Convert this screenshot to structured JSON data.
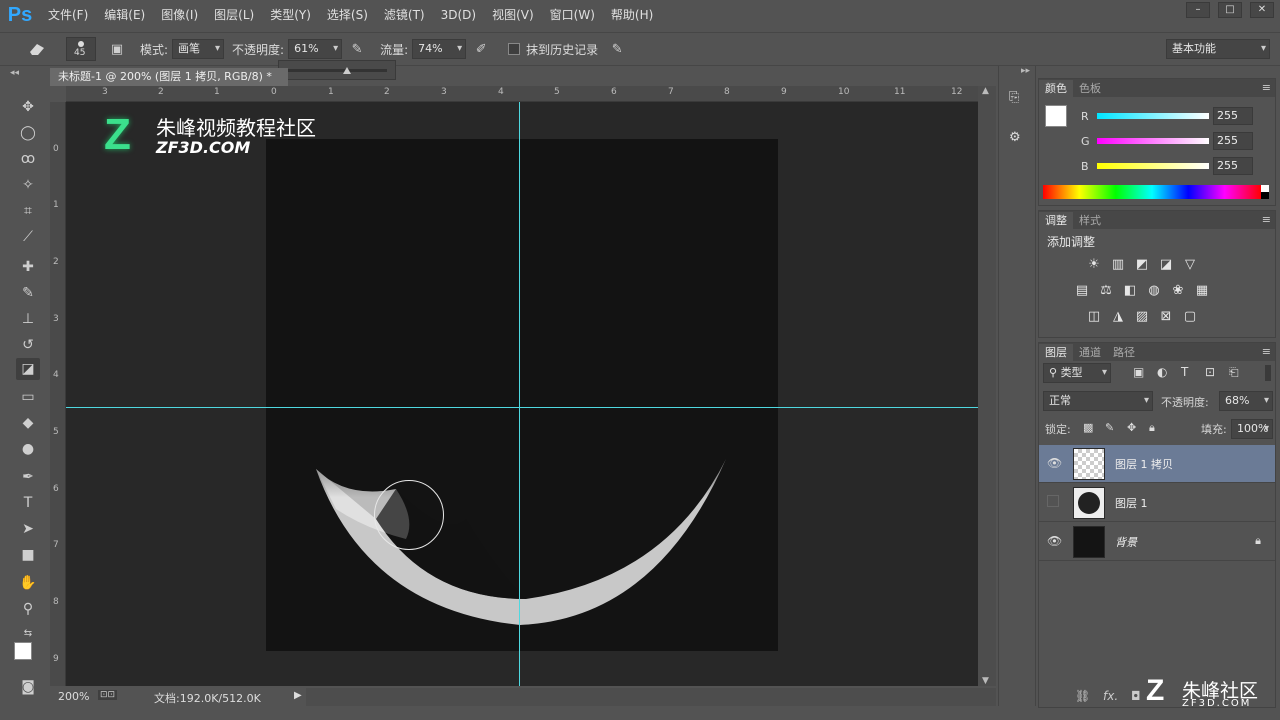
{
  "app": {
    "logo": "Ps",
    "menu": [
      "文件(F)",
      "编辑(E)",
      "图像(I)",
      "图层(L)",
      "类型(Y)",
      "选择(S)",
      "滤镜(T)",
      "3D(D)",
      "视图(V)",
      "窗口(W)",
      "帮助(H)"
    ],
    "window_controls": [
      "–",
      "□",
      "✕"
    ]
  },
  "options": {
    "brush_size": "45",
    "mode_label": "模式:",
    "mode_value": "画笔",
    "opacity_label": "不透明度:",
    "opacity_value": "61%",
    "flow_label": "流量:",
    "flow_value": "74%",
    "erase_history_label": "抹到历史记录",
    "workspace": "基本功能"
  },
  "document": {
    "tab_title": "未标题-1 @ 200% (图层 1 拷贝, RGB/8) *",
    "ruler_top": [
      "3",
      "2",
      "1",
      "0",
      "1",
      "2",
      "3",
      "4",
      "5",
      "6",
      "7",
      "8",
      "9",
      "10",
      "11",
      "12"
    ],
    "ruler_left": [
      "0",
      "1",
      "2",
      "3",
      "4",
      "5",
      "6",
      "7",
      "8",
      "9"
    ]
  },
  "watermark": {
    "cn": "朱峰视频教程社区",
    "en": "ZF3D.COM",
    "bottom_cn": "朱峰社区",
    "bottom_en": "ZF3D.COM"
  },
  "status": {
    "zoom": "200%",
    "doc_size": "文档:192.0K/512.0K"
  },
  "color_panel": {
    "tabs": [
      "颜色",
      "色板"
    ],
    "channels": [
      {
        "label": "R",
        "value": "255",
        "color": "#00e5ff"
      },
      {
        "label": "G",
        "value": "255",
        "color": "#ff00ff"
      },
      {
        "label": "B",
        "value": "255",
        "color": "#ffff00"
      }
    ]
  },
  "adjust_panel": {
    "tabs": [
      "调整",
      "样式"
    ],
    "title": "添加调整"
  },
  "layers_panel": {
    "tabs": [
      "图层",
      "通道",
      "路径"
    ],
    "filter": "类型",
    "blend_mode": "正常",
    "opacity_label": "不透明度:",
    "opacity_value": "68%",
    "lock_label": "锁定:",
    "fill_label": "填充:",
    "fill_value": "100%",
    "layers": [
      {
        "name": "图层 1 拷贝",
        "visible": true,
        "selected": true
      },
      {
        "name": "图层 1",
        "visible": false,
        "selected": false
      },
      {
        "name": "背景",
        "visible": true,
        "selected": false,
        "locked": true
      }
    ],
    "footer_icons": [
      "link-icon",
      "fx-icon",
      "mask-icon"
    ],
    "fx_label": "fx."
  }
}
